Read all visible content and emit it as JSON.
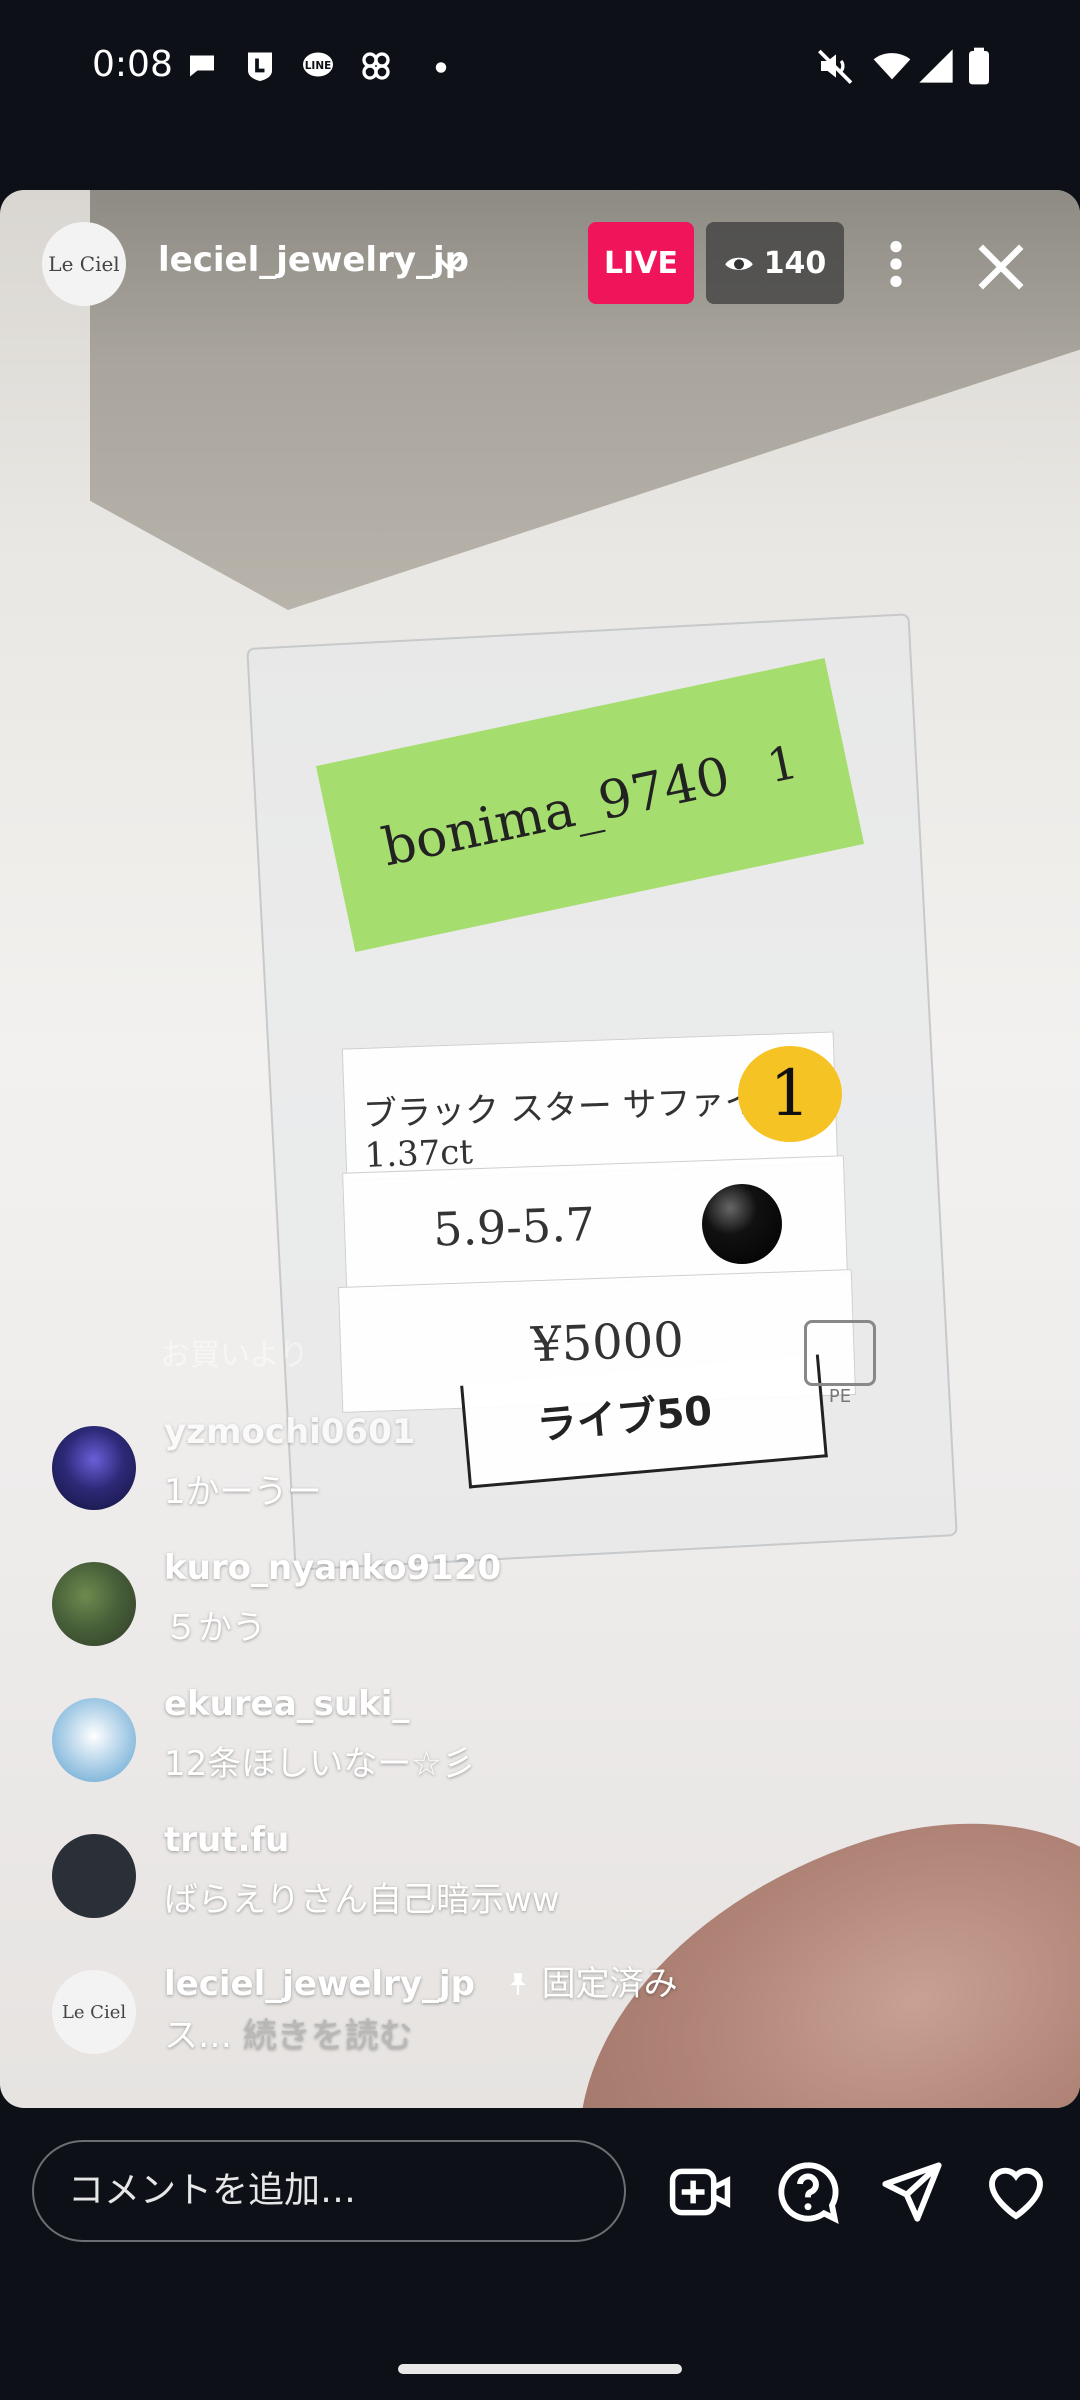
{
  "status_bar": {
    "time": "0:08",
    "notification_icons": [
      "chat-bubble-icon",
      "l-app-icon",
      "line-app-icon",
      "pinwheel-icon",
      "dot-icon"
    ],
    "right_icons": [
      "mute-icon",
      "wifi-icon",
      "signal-icon",
      "battery-icon"
    ]
  },
  "header": {
    "avatar_text": "Le Ciel",
    "username": "leciel_jewelry_jp",
    "live_label": "LIVE",
    "viewer_count": "140"
  },
  "video": {
    "sticky_text": "bonima_9740",
    "sticky_mark": "1",
    "card_row1": "ブラック スター サファイア  1.37ct",
    "card_row1_badge": "1",
    "card_row2": "5.9-5.7",
    "card_row3": "¥5000",
    "card_label": "ライブ50",
    "recycle_mark": "PE"
  },
  "comments": {
    "faded_text": "お買いより",
    "items": [
      {
        "user": "yzmochi0601",
        "text": "1かーうー",
        "avatar": "night-lights-avatar"
      },
      {
        "user": "kuro_nyanko9120",
        "text": "５かう",
        "avatar": "garden-avatar"
      },
      {
        "user": "ekurea_suki_",
        "text": "12条ほしいなー☆彡",
        "avatar": "dolphins-avatar"
      },
      {
        "user": "trut.fu",
        "text": "ばらえりさん自己暗示ww",
        "avatar": "dark-avatar"
      },
      {
        "user": "leciel_jewelry_jp",
        "pinned": "固定済み",
        "text_start": "ス…",
        "read_more": "続きを読む",
        "avatar": "leciel-avatar"
      }
    ]
  },
  "bottom": {
    "input_placeholder": "コメントを追加…",
    "actions": [
      "add-video-icon",
      "question-icon",
      "share-icon",
      "heart-icon"
    ]
  },
  "colors": {
    "live_red": "#f0145a",
    "background": "#0d1117"
  }
}
